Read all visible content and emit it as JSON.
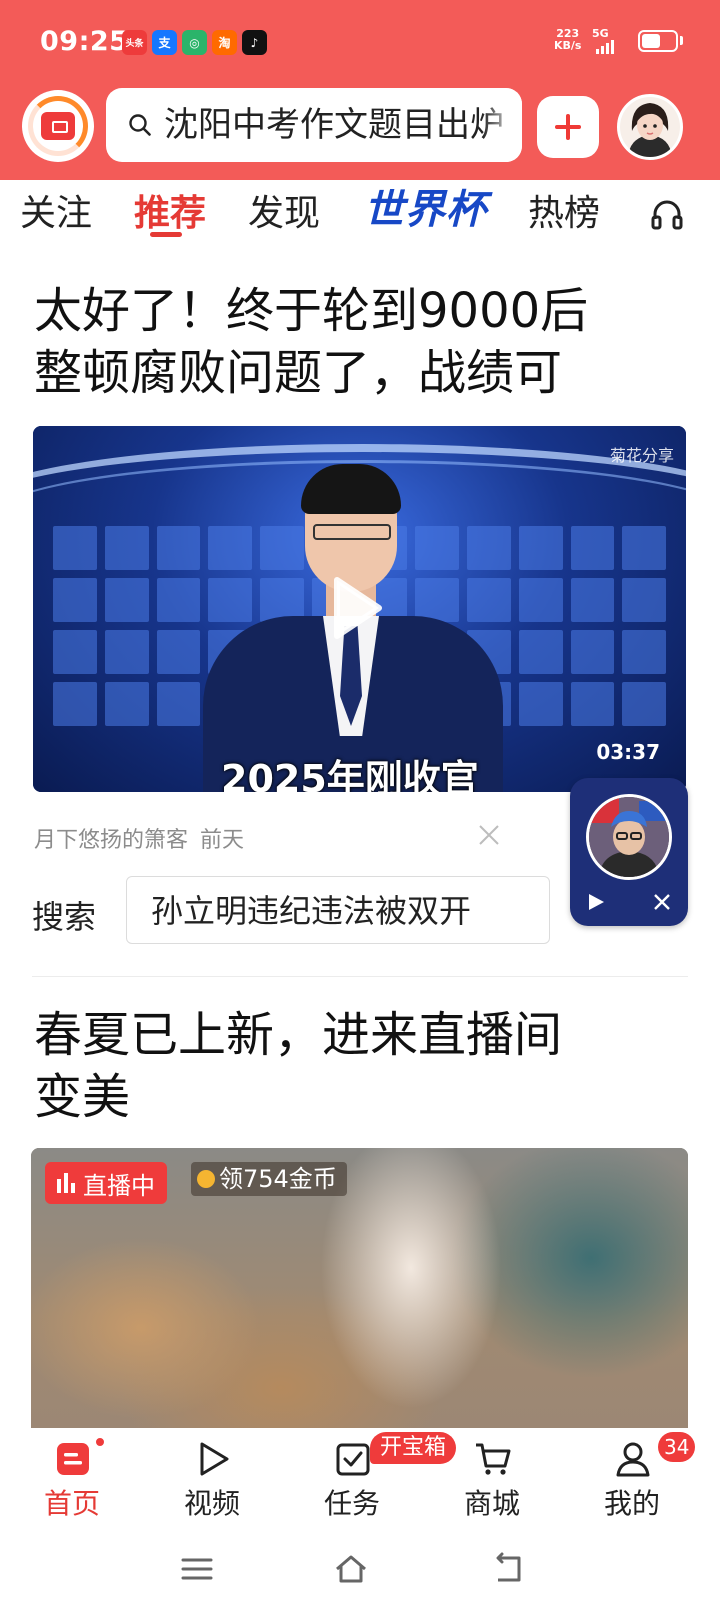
{
  "status_bar": {
    "time": "09:25",
    "apps": [
      {
        "icon": "toutiao-app-icon",
        "glyph": "头条",
        "color": "#ee3b3b"
      },
      {
        "icon": "alipay-app-icon",
        "glyph": "支",
        "color": "#1677ff"
      },
      {
        "icon": "wechat-mini-app-icon",
        "glyph": "◎",
        "color": "#2bb46a"
      },
      {
        "icon": "taobao-app-icon",
        "glyph": "淘",
        "color": "#ff6a00"
      },
      {
        "icon": "tiktok-app-icon",
        "glyph": "♪",
        "color": "#111111"
      }
    ],
    "net_speed_value": "223",
    "net_speed_unit": "KB/s",
    "network": "5G",
    "battery_level": 0.55
  },
  "header": {
    "search_placeholder": "沈阳中考作文题目出炉",
    "add_button_label": "+",
    "accent_color": "#f35b58"
  },
  "tabs": [
    {
      "label": "关注",
      "active": false
    },
    {
      "label": "推荐",
      "active": true
    },
    {
      "label": "发现",
      "active": false
    },
    {
      "label": "世界杯",
      "active": false
    },
    {
      "label": "热榜",
      "active": false
    }
  ],
  "article1": {
    "title_line1": "太好了！终于轮到9000后",
    "title_line2": "整顿腐败问题了，战绩可",
    "video_watermark": "菊花分享",
    "video_caption": "2025年刚收官",
    "video_duration": "03:37",
    "author": "月下悠扬的箫客",
    "posted": "前天",
    "search_label": "搜索",
    "search_suggestion": "孙立明违纪违法被双开"
  },
  "article2": {
    "title_line1": "春夏已上新，进来直播间",
    "title_line2": "变美",
    "live_badge": "直播中",
    "coin_reward": "领754金币"
  },
  "bottom_nav": [
    {
      "label": "首页",
      "icon": "home-icon",
      "active": true
    },
    {
      "label": "视频",
      "icon": "video-play-icon",
      "active": false
    },
    {
      "label": "任务",
      "icon": "task-check-icon",
      "active": false
    },
    {
      "label": "商城",
      "icon": "cart-icon",
      "active": false
    },
    {
      "label": "我的",
      "icon": "profile-icon",
      "active": false
    }
  ],
  "task_chip": "开宝箱",
  "profile_badge": "34"
}
